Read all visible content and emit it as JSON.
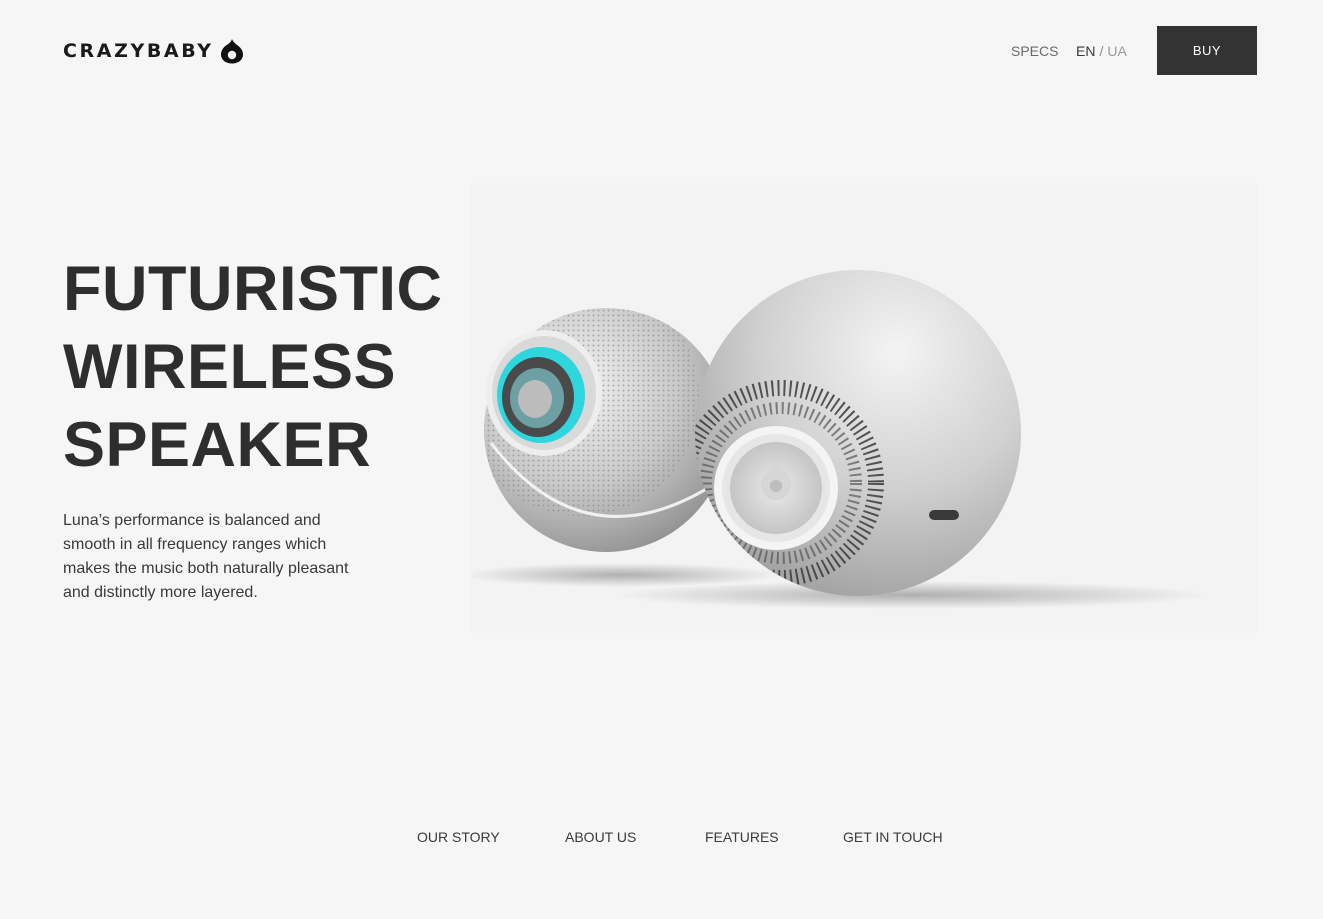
{
  "header": {
    "logo_text": "CRAZYBABY",
    "nav_specs": "SPECS",
    "lang_active": "EN",
    "lang_separator": "/",
    "lang_other": "UA",
    "buy_label": "BUY"
  },
  "hero": {
    "title_line1": "FUTURISTIC",
    "title_line2": "WIRELESS",
    "title_line3": "SPEAKER",
    "description": "Luna’s performance is balanced and smooth in all frequency ranges which makes the music both naturally pleasant and distinctly more layered."
  },
  "footer_nav": {
    "items": [
      "OUR STORY",
      "ABOUT US",
      "FEATURES",
      "GET IN TOUCH"
    ]
  },
  "colors": {
    "background": "#f6f6f6",
    "button": "#333333",
    "accent": "#2fd6de",
    "text": "#2e2e2e"
  }
}
